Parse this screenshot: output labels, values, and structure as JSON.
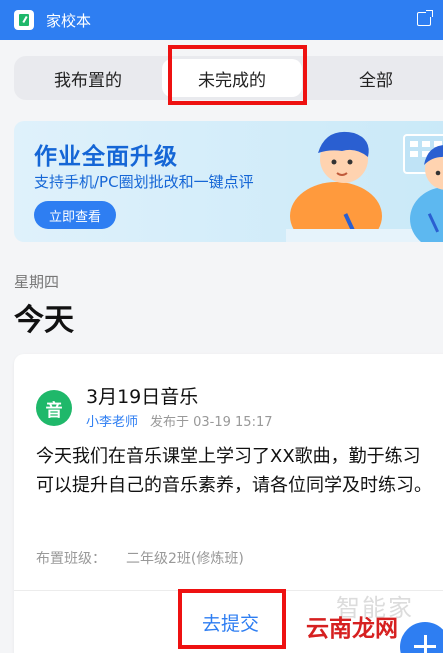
{
  "window": {
    "title": "家校本"
  },
  "tabs": [
    {
      "label": "我布置的"
    },
    {
      "label": "未完成的"
    },
    {
      "label": "全部"
    }
  ],
  "banner": {
    "title": "作业全面升级",
    "subtitle": "支持手机/PC圈划批改和一键点评",
    "button": "立即查看"
  },
  "section": {
    "weekday": "星期四",
    "heading": "今天"
  },
  "homework": {
    "avatar": "音",
    "title": "3月19日音乐",
    "teacher": "小李老师",
    "published": "发布于 03-19 15:17",
    "content": "今天我们在音乐课堂上学习了XX歌曲，勤于练习可以提升自己的音乐素养，请各位同学及时练习。",
    "class_label": "布置班级：",
    "class_value": "二年级2班(修炼班)",
    "submit": "去提交"
  },
  "watermark": {
    "faint": "智能家",
    "text": "云南龙网"
  },
  "colors": {
    "primary": "#2e7ef2",
    "avatar": "#1fb86a",
    "highlight": "#ee1111"
  }
}
